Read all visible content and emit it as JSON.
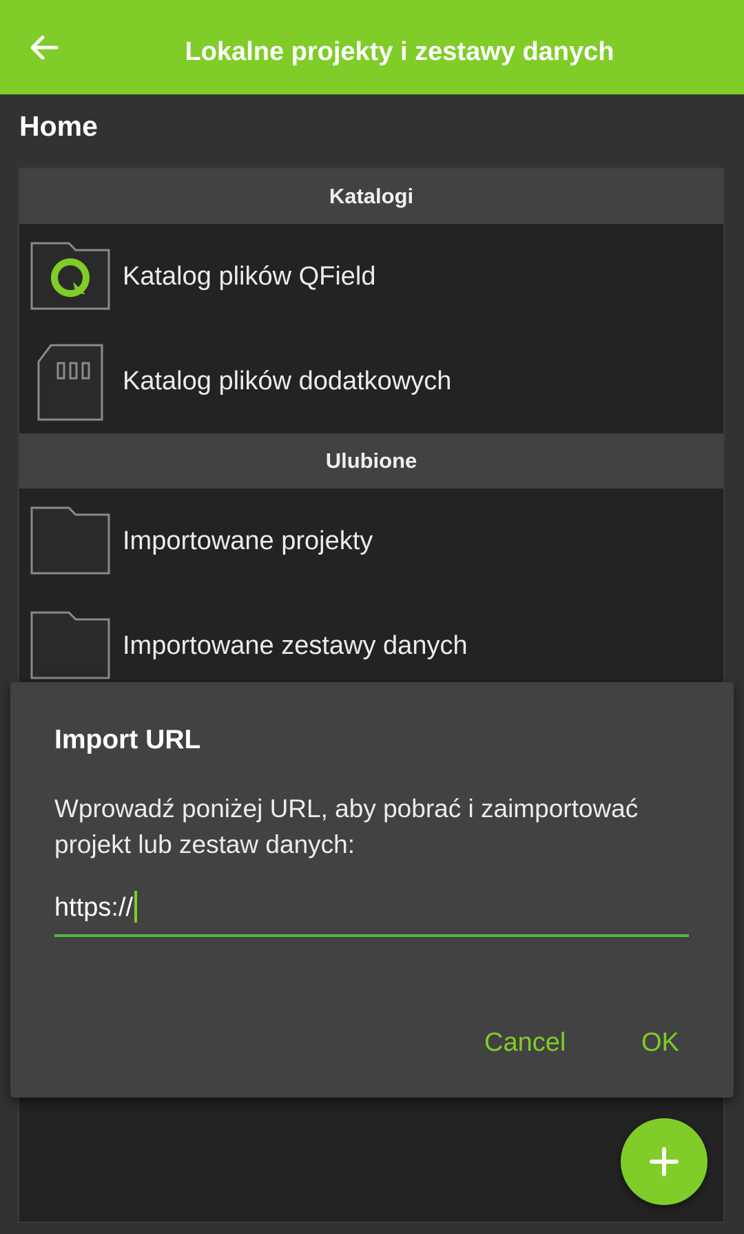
{
  "header": {
    "title": "Lokalne projekty i zestawy danych",
    "back_icon": "arrow-left-icon",
    "background_color": "#80cc28"
  },
  "breadcrumb": "Home",
  "sections": [
    {
      "title": "Katalogi",
      "items": [
        {
          "label": "Katalog plików QField",
          "icon": "qfield-folder-icon"
        },
        {
          "label": "Katalog plików dodatkowych",
          "icon": "sd-card-icon"
        }
      ]
    },
    {
      "title": "Ulubione",
      "items": [
        {
          "label": "Importowane projekty",
          "icon": "folder-icon"
        },
        {
          "label": "Importowane zestawy danych",
          "icon": "folder-icon"
        }
      ]
    }
  ],
  "dialog": {
    "title": "Import URL",
    "message": "Wprowadź poniżej URL, aby pobrać i zaimportować projekt lub zestaw danych:",
    "url_value": "https://",
    "cancel_label": "Cancel",
    "ok_label": "OK"
  },
  "fab": {
    "icon": "plus-icon"
  },
  "colors": {
    "accent": "#80cc28",
    "input_underline": "#4cb848",
    "panel": "#232323",
    "section_header": "#424242",
    "dialog": "#424242"
  }
}
